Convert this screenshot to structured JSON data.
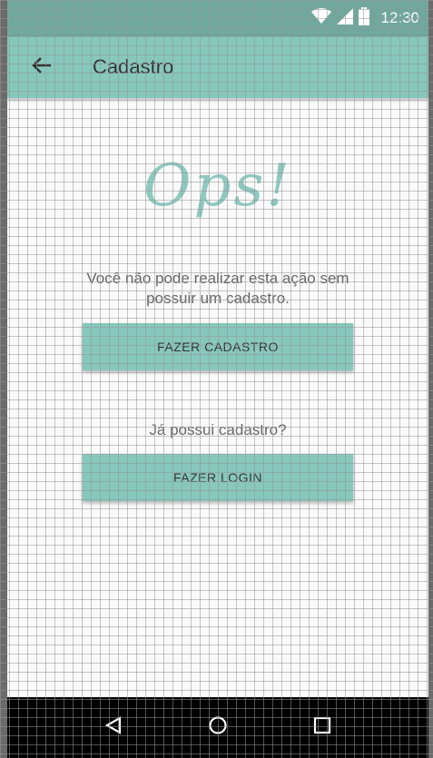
{
  "status_bar": {
    "time": "12:30",
    "icons": [
      "wifi-icon",
      "signal-icon",
      "battery-icon"
    ],
    "color": "#6fa89d"
  },
  "app_bar": {
    "title": "Cadastro",
    "back_icon": "arrow-back-icon",
    "color": "#86c8bc"
  },
  "main": {
    "headline": "Ops!",
    "message": "Você não pode realizar esta ação sem possuir um cadastro.",
    "signup_button": "FAZER CADASTRO",
    "question": "Já possui cadastro?",
    "login_button": "FAZER LOGIN",
    "accent_color": "#86c8bc"
  },
  "nav_bar": {
    "icons": [
      "back-triangle-icon",
      "home-circle-icon",
      "recents-square-icon"
    ]
  }
}
